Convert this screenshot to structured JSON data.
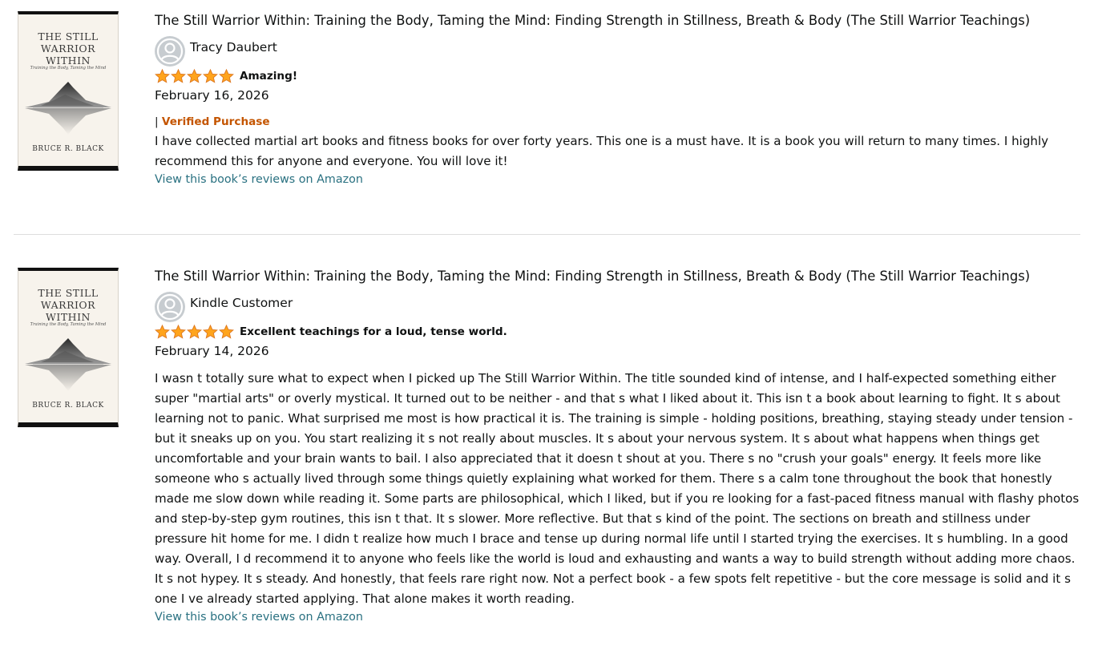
{
  "reviews": [
    {
      "cover": {
        "title": "THE STILL\nWARRIOR\nWITHIN",
        "subtitle": "Training the Body, Taming the Mind",
        "author": "BRUCE R. BLACK"
      },
      "book_title": "The Still Warrior Within: Training the Body, Taming the Mind: Finding Strength in Stillness, Breath & Body (The Still Warrior Teachings)",
      "reviewer": "Tracy Daubert",
      "rating": 5,
      "headline": "Amazing!",
      "date": "February 16, 2026",
      "verified_prefix": "|",
      "verified_label": "Verified Purchase",
      "body": "I have collected martial art books and fitness books for over forty years. This one is a must have. It is a book you will return to many times. I highly recommend this for anyone and everyone. You will love it!",
      "link_label": "View this book’s reviews on Amazon"
    },
    {
      "cover": {
        "title": "THE STILL\nWARRIOR\nWITHIN",
        "subtitle": "Training the Body, Taming the Mind",
        "author": "BRUCE R. BLACK"
      },
      "book_title": "The Still Warrior Within: Training the Body, Taming the Mind: Finding Strength in Stillness, Breath & Body (The Still Warrior Teachings)",
      "reviewer": "Kindle Customer",
      "rating": 5,
      "headline": "Excellent teachings for a loud, tense world.",
      "date": "February 14, 2026",
      "body": "I wasn t totally sure what to expect when I picked up The Still Warrior Within. The title sounded kind of intense, and I half-expected something either super \"martial arts\" or overly mystical. It turned out to be neither - and that s what I liked about it. This isn t a book about learning to fight. It s about learning not to panic. What surprised me most is how practical it is. The training is simple - holding positions, breathing, staying steady under tension - but it sneaks up on you. You start realizing it s not really about muscles. It s about your nervous system. It s about what happens when things get uncomfortable and your brain wants to bail. I also appreciated that it doesn t shout at you. There s no \"crush your goals\" energy. It feels more like someone who s actually lived through some things quietly explaining what worked for them. There s a calm tone throughout the book that honestly made me slow down while reading it. Some parts are philosophical, which I liked, but if you re looking for a fast-paced fitness manual with flashy photos and step-by-step gym routines, this isn t that. It s slower. More reflective. But that s kind of the point. The sections on breath and stillness under pressure hit home for me. I didn t realize how much I brace and tense up during normal life until I started trying the exercises. It s humbling. In a good way. Overall, I d recommend it to anyone who feels like the world is loud and exhausting and wants a way to build strength without adding more chaos. It s not hypey. It s steady. And honestly, that feels rare right now. Not a perfect book - a few spots felt repetitive - but the core message is solid and it s one I ve already started applying. That alone makes it worth reading.",
      "link_label": "View this book’s reviews on Amazon"
    }
  ],
  "colors": {
    "star": "#ffa41c",
    "star_stroke": "#de7921",
    "verified": "#c45500",
    "link": "#2a7181",
    "avatar_bg": "#c7ccd0",
    "divider": "#dddddd"
  }
}
